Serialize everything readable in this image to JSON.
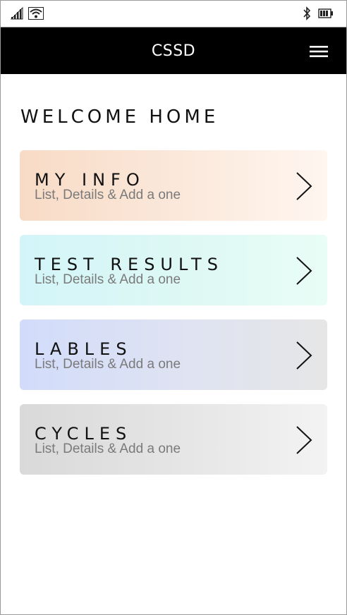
{
  "status": {
    "signal_icon": "signal-bars-icon",
    "wifi_icon": "wifi-icon",
    "bluetooth_icon": "bluetooth-icon",
    "battery_icon": "battery-icon"
  },
  "header": {
    "title": "CSSD",
    "menu_icon": "hamburger-menu-icon"
  },
  "main": {
    "heading": "WELCOME HOME",
    "cards": [
      {
        "title": "MY INFO",
        "subtitle": "List, Details & Add a one",
        "icon": "chevron-right-icon"
      },
      {
        "title": "TEST RESULTS",
        "subtitle": "List, Details & Add a one",
        "icon": "chevron-right-icon"
      },
      {
        "title": "LABLES",
        "subtitle": "List, Details & Add a one",
        "icon": "chevron-right-icon"
      },
      {
        "title": "CYCLES",
        "subtitle": "List, Details & Add a one",
        "icon": "chevron-right-icon"
      }
    ]
  },
  "colors": {
    "appbar_bg": "#000000",
    "card1_gradient": [
      "#f8dbc6",
      "#fff6f0"
    ],
    "card2_gradient": [
      "#d3f5f9",
      "#e9fdf6"
    ],
    "card3_gradient": [
      "#d2dcfa",
      "#e6e6e6"
    ],
    "card4_gradient": [
      "#d9d9d9",
      "#f3f3f3"
    ]
  }
}
